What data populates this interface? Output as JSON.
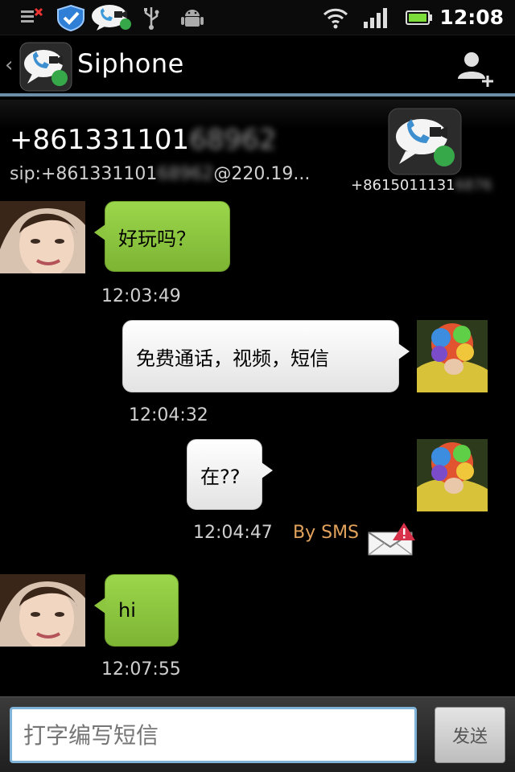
{
  "status_bar": {
    "time": "12:08",
    "icons": [
      "sim-icon",
      "shield-icon",
      "siphone-notification-icon",
      "usb-icon",
      "android-icon",
      "wifi-icon",
      "signal-icon",
      "battery-icon"
    ]
  },
  "header": {
    "back_glyph": "‹",
    "title": "Siphone",
    "add_contact_icon": "add-contact-icon"
  },
  "contact": {
    "number": "+861331101",
    "number_blurred": "68962",
    "sip_prefix": "sip:+861331101",
    "sip_blurred": "68962",
    "sip_suffix": "@220.19...",
    "own_number": "+8615011131",
    "own_number_blurred": "6876"
  },
  "messages": [
    {
      "direction": "incoming",
      "text": "好玩吗？",
      "time": "12:03:49"
    },
    {
      "direction": "outgoing",
      "text": "免费通话，视频，短信",
      "time": "12:04:32"
    },
    {
      "direction": "outgoing",
      "text": "在??",
      "time": "12:04:47",
      "via": "By SMS"
    },
    {
      "direction": "incoming",
      "text": "hi",
      "time": "12:07:55"
    }
  ],
  "composer": {
    "placeholder": "打字编写短信",
    "send_label": "发送"
  },
  "colors": {
    "incoming_bubble": "#8cc63f",
    "outgoing_bubble": "#f2f2f2",
    "header_divider": "#6c8ea9",
    "sms_label": "#e3a35c",
    "input_border": "#7fb3d8"
  }
}
